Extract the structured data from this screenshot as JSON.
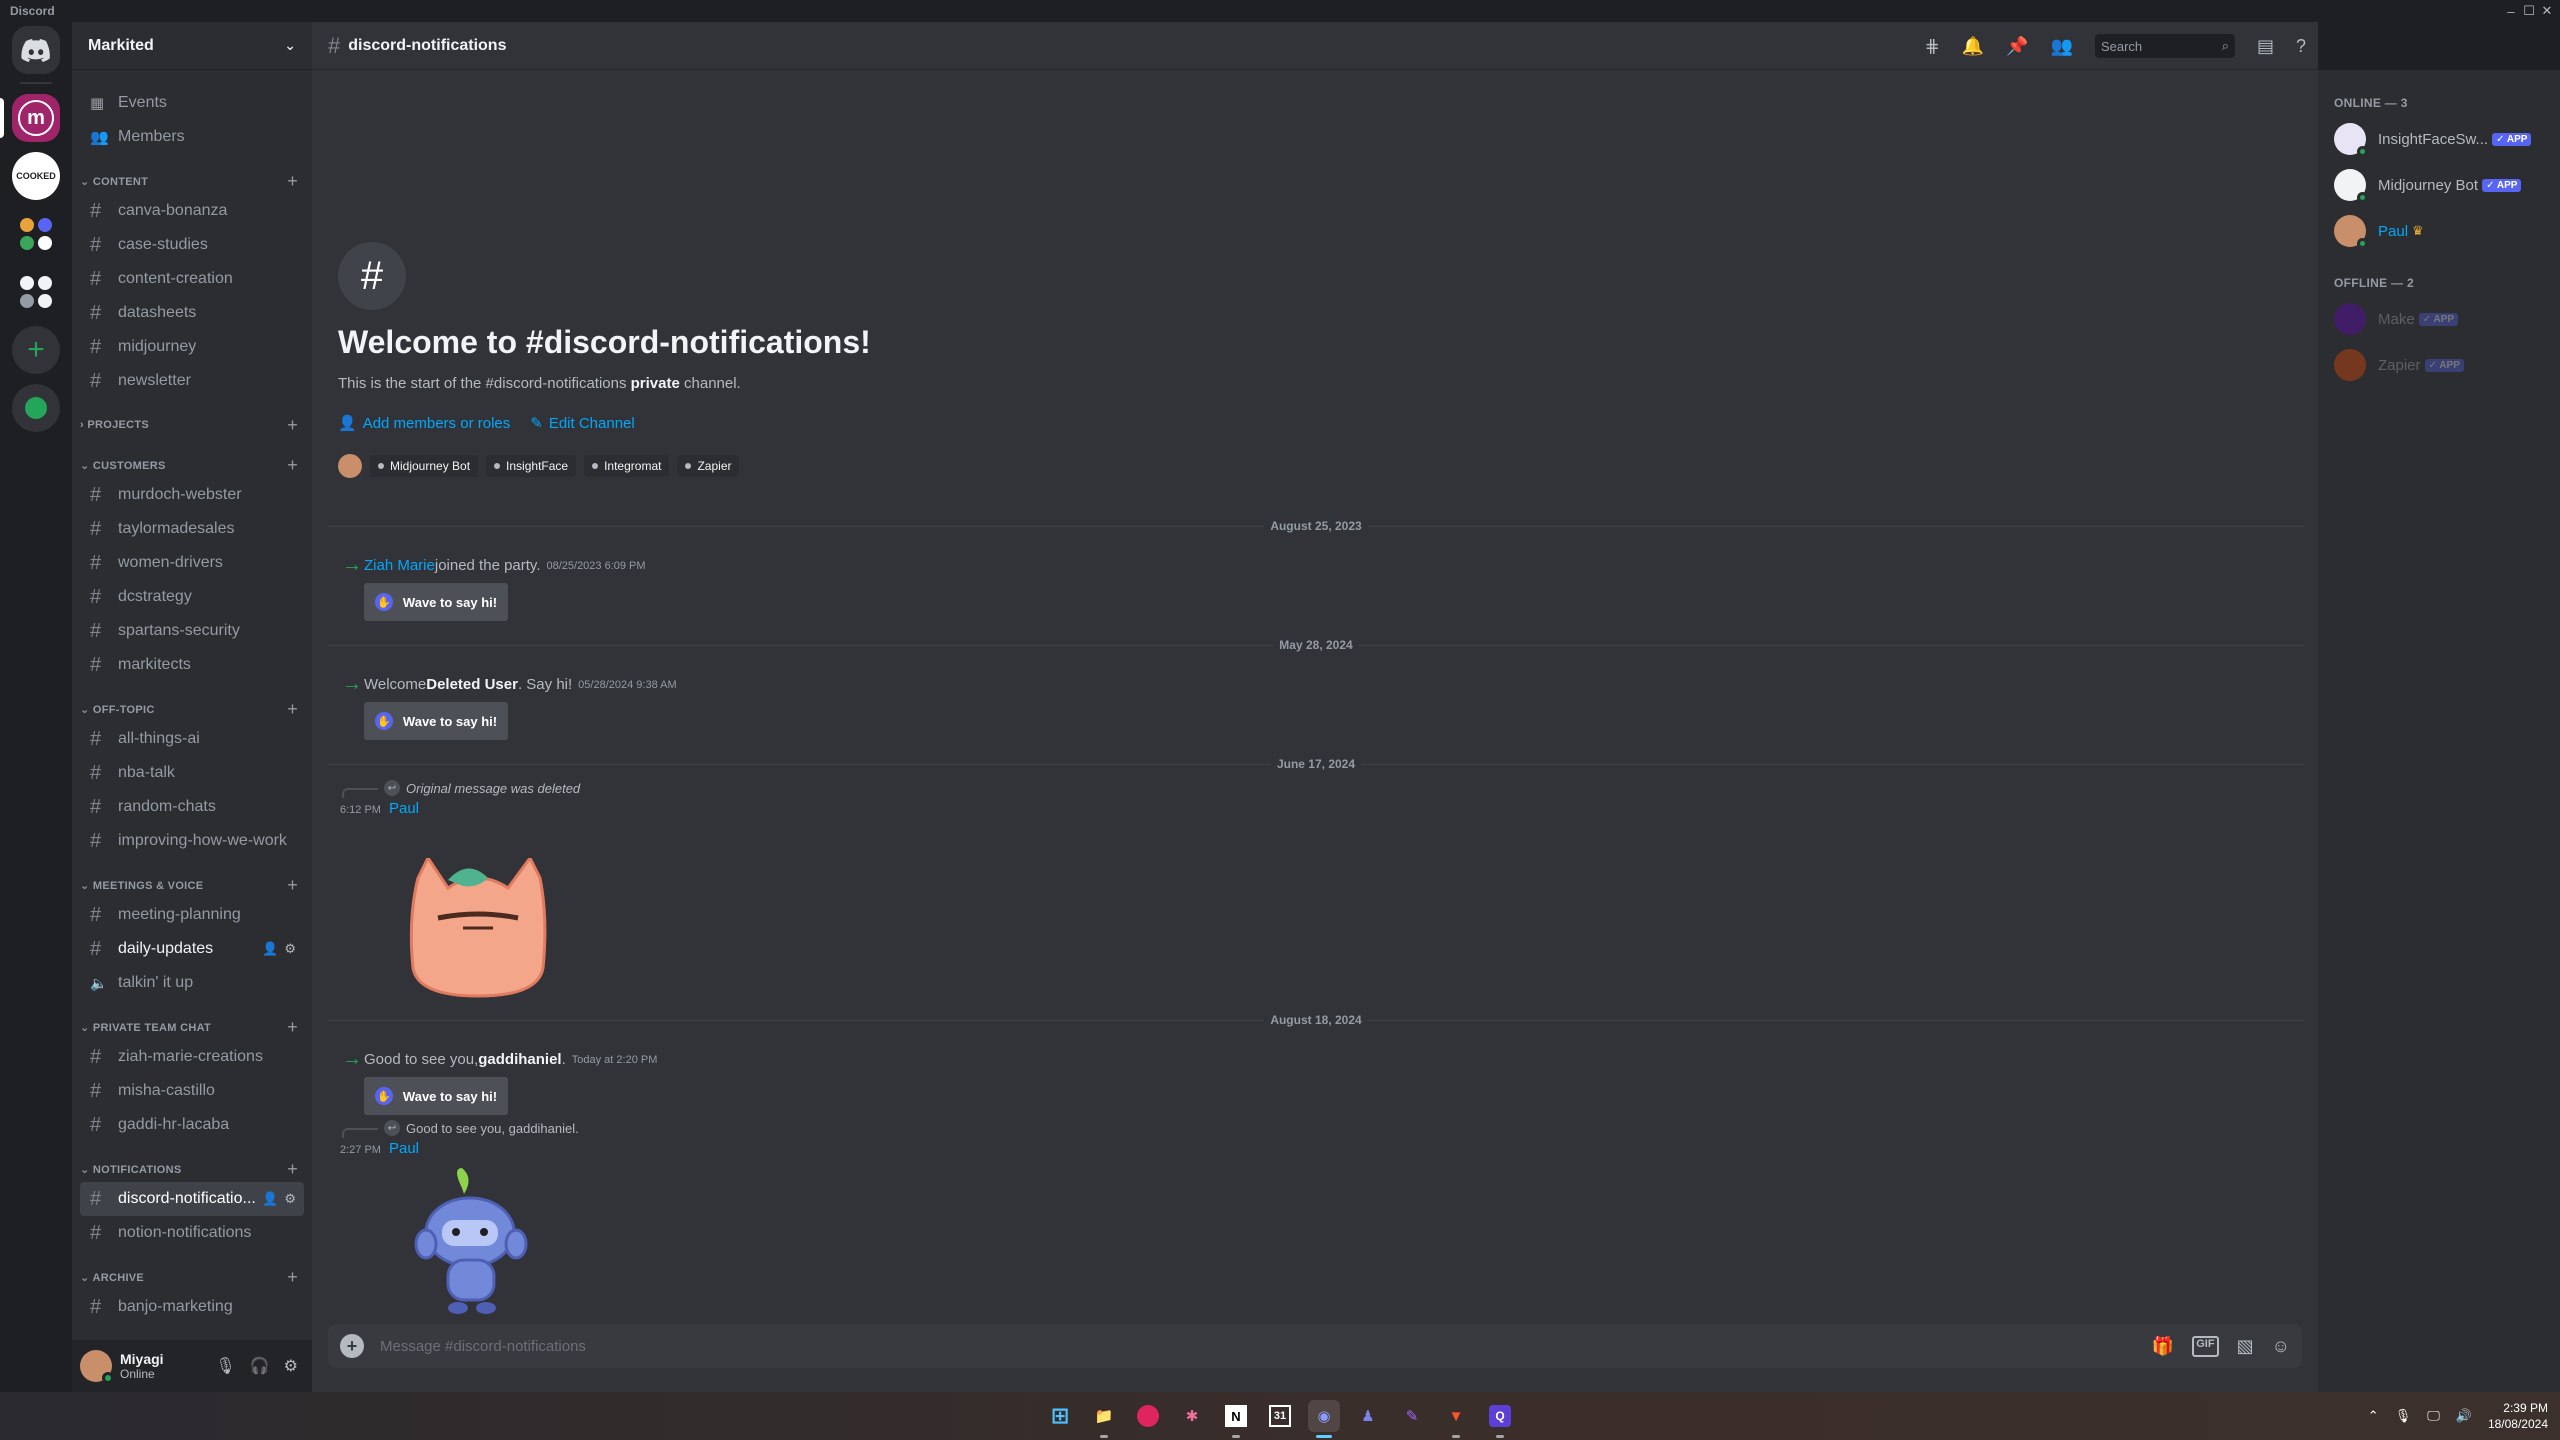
{
  "window": {
    "title": "Discord",
    "controls": [
      "–",
      "☐",
      "✕"
    ]
  },
  "rail": {
    "servers": [
      {
        "name": "home",
        "label": ""
      },
      {
        "name": "markited",
        "label": "m"
      },
      {
        "name": "cooked",
        "label": ""
      },
      {
        "name": "folder-1",
        "label": ""
      },
      {
        "name": "folder-2",
        "label": ""
      }
    ]
  },
  "guild": {
    "name": "Markited"
  },
  "sidebar": {
    "utilities": [
      {
        "icon": "calendar-icon",
        "label": "Events"
      },
      {
        "icon": "members-icon",
        "label": "Members"
      }
    ],
    "categories": [
      {
        "name": "CONTENT",
        "channels": [
          "canva-bonanza",
          "case-studies",
          "content-creation",
          "datasheets",
          "midjourney",
          "newsletter"
        ]
      },
      {
        "name": "PROJECTS",
        "channels": []
      },
      {
        "name": "CUSTOMERS",
        "channels": [
          "murdoch-webster",
          "taylormadesales",
          "women-drivers",
          "dcstrategy",
          "spartans-security",
          "markitects"
        ]
      },
      {
        "name": "OFF-TOPIC",
        "channels": [
          "all-things-ai",
          "nba-talk",
          "random-chats",
          "improving-how-we-work"
        ]
      },
      {
        "name": "MEETINGS & VOICE",
        "channels": [
          "meeting-planning",
          "daily-updates",
          "talkin' it up"
        ]
      },
      {
        "name": "PRIVATE TEAM CHAT",
        "channels": [
          "ziah-marie-creations",
          "misha-castillo",
          "gaddi-hr-lacaba"
        ]
      },
      {
        "name": "NOTIFICATIONS",
        "channels": [
          "discord-notificatio...",
          "notion-notifications"
        ]
      },
      {
        "name": "ARCHIVE",
        "channels": [
          "banjo-marketing"
        ]
      }
    ]
  },
  "user": {
    "name": "Miyagi",
    "status": "Online"
  },
  "channel": {
    "name": "discord-notifications",
    "search_placeholder": "Search"
  },
  "welcome": {
    "title": "Welcome to #discord-notifications!",
    "sub_prefix": "This is the start of the #discord-notifications ",
    "sub_bold": "private",
    "sub_suffix": " channel.",
    "add_members": "Add members or roles",
    "edit_channel": "Edit Channel",
    "chips": [
      "Midjourney Bot",
      "InsightFace",
      "Integromat",
      "Zapier"
    ]
  },
  "messages": {
    "date1": "August 25, 2023",
    "m1": {
      "who": "Ziah Marie",
      "text": " joined the party.",
      "ts": "08/25/2023 6:09 PM",
      "button": "Wave to say hi!"
    },
    "date2": "May 28, 2024",
    "m2": {
      "prefix": "Welcome ",
      "who": "Deleted User",
      "text": ". Say hi!",
      "ts": "05/28/2024 9:38 AM",
      "button": "Wave to say hi!"
    },
    "date3": "June 17, 2024",
    "m3": {
      "reply": "Original message was deleted",
      "ts": "6:12 PM",
      "author": "Paul"
    },
    "date4": "August 18, 2024",
    "m4": {
      "prefix": "Good to see you, ",
      "who": "gaddihaniel",
      "text": ".",
      "ts": "Today at 2:20 PM",
      "button": "Wave to say hi!"
    },
    "m5": {
      "reply": "Good to see you, gaddihaniel.",
      "ts": "2:27 PM",
      "author": "Paul"
    }
  },
  "composer": {
    "placeholder": "Message #discord-notifications",
    "gif": "GIF"
  },
  "member_list": {
    "online_header": "ONLINE — 3",
    "online": [
      {
        "name": "InsightFaceSw...",
        "badge": "✓ APP",
        "color": "#b5bac1"
      },
      {
        "name": "Midjourney Bot",
        "badge": "✓ APP",
        "color": "#b5bac1"
      },
      {
        "name": "Paul",
        "badge": "",
        "color": "#00a8fc"
      }
    ],
    "offline_header": "OFFLINE — 2",
    "offline": [
      {
        "name": "Make",
        "badge": "✓ APP"
      },
      {
        "name": "Zapier",
        "badge": "✓ APP"
      }
    ]
  },
  "taskbar": {
    "time": "2:39 PM",
    "date": "18/08/2024"
  }
}
